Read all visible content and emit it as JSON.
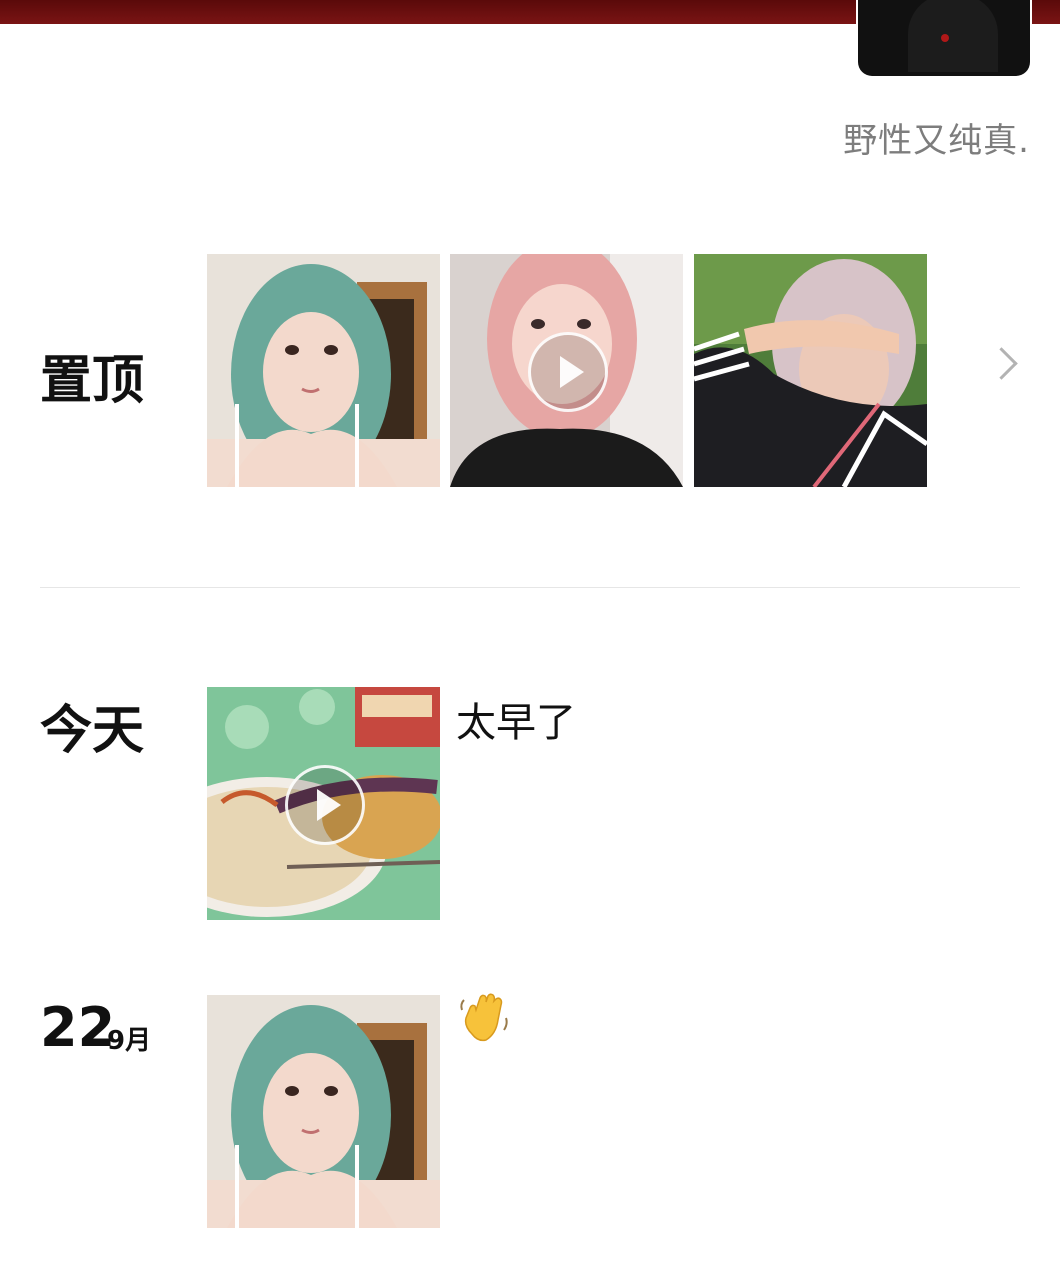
{
  "profile": {
    "signature": "野性又纯真."
  },
  "pinned": {
    "label": "置顶",
    "items": [
      {
        "kind": "photo",
        "subject": "teal-hair-portrait"
      },
      {
        "kind": "video",
        "subject": "pink-hair-selfie"
      },
      {
        "kind": "photo",
        "subject": "shading-eyes-outdoor"
      }
    ]
  },
  "posts": [
    {
      "date_label": "今天",
      "caption": "太早了",
      "media_kind": "video",
      "subject": "noodle-dumpling-meal"
    },
    {
      "date_day": "22",
      "date_month": "9月",
      "caption_emoji": "waving-hand-emoji",
      "media_kind": "photo",
      "subject": "teal-hair-portrait"
    }
  ],
  "colors": {
    "cover": "#6b0f0f",
    "signature": "#7d7d7d",
    "divider": "#e6e6e6"
  }
}
